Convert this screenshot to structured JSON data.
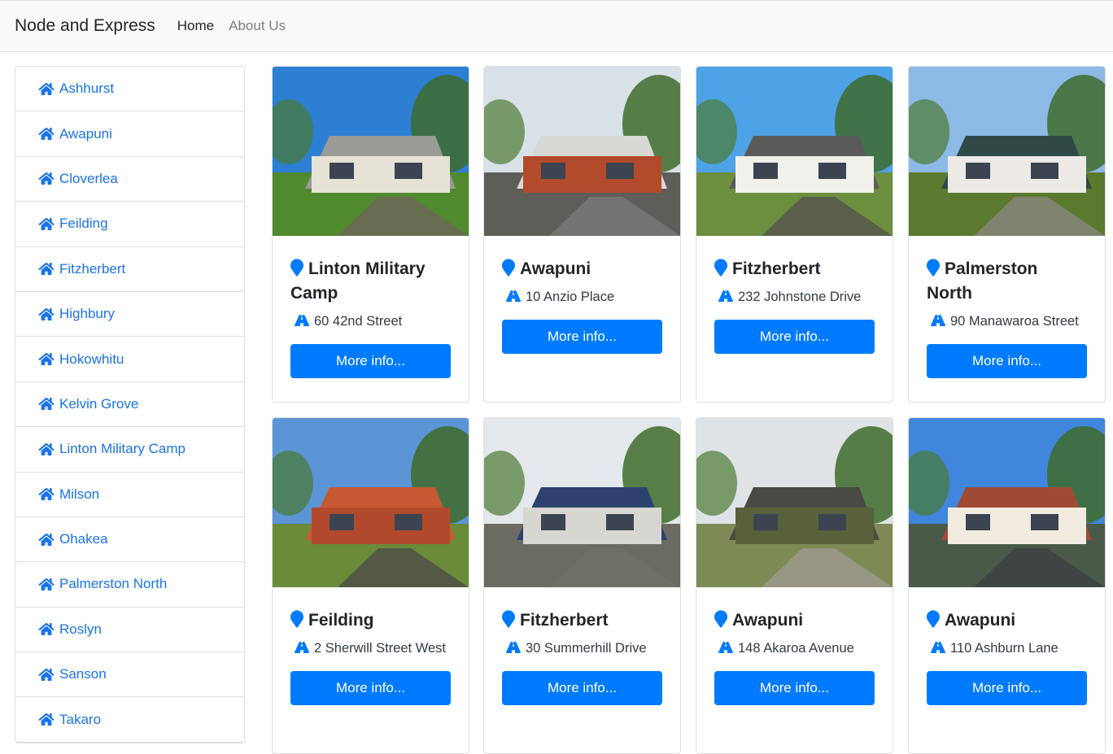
{
  "navbar": {
    "brand": "Node and Express",
    "links": [
      "Home",
      "About Us"
    ]
  },
  "sidebar": {
    "icon": "home-icon",
    "items": [
      "Ashhurst",
      "Awapuni",
      "Cloverlea",
      "Feilding",
      "Fitzherbert",
      "Highbury",
      "Hokowhitu",
      "Kelvin Grove",
      "Linton Military Camp",
      "Milson",
      "Ohakea",
      "Palmerston North",
      "Roslyn",
      "Sanson",
      "Takaro"
    ]
  },
  "listings": {
    "button_label": "More info...",
    "title_icon": "map-marker-icon",
    "address_icon": "road-icon",
    "cards": [
      {
        "suburb": "Linton Military Camp",
        "address": "60 42nd Street"
      },
      {
        "suburb": "Awapuni",
        "address": "10 Anzio Place"
      },
      {
        "suburb": "Fitzherbert",
        "address": "232 Johnstone Drive"
      },
      {
        "suburb": "Palmerston North",
        "address": "90 Manawaroa Street"
      },
      {
        "suburb": "Feilding",
        "address": "2 Sherwill Street West"
      },
      {
        "suburb": "Fitzherbert",
        "address": "30 Summerhill Drive"
      },
      {
        "suburb": "Awapuni",
        "address": "148 Akaroa Avenue"
      },
      {
        "suburb": "Awapuni",
        "address": "110 Ashburn Lane"
      }
    ]
  },
  "colors": {
    "accent": "#007bff",
    "link": "#1a73e8",
    "navbar_bg": "#f8f9fa"
  }
}
